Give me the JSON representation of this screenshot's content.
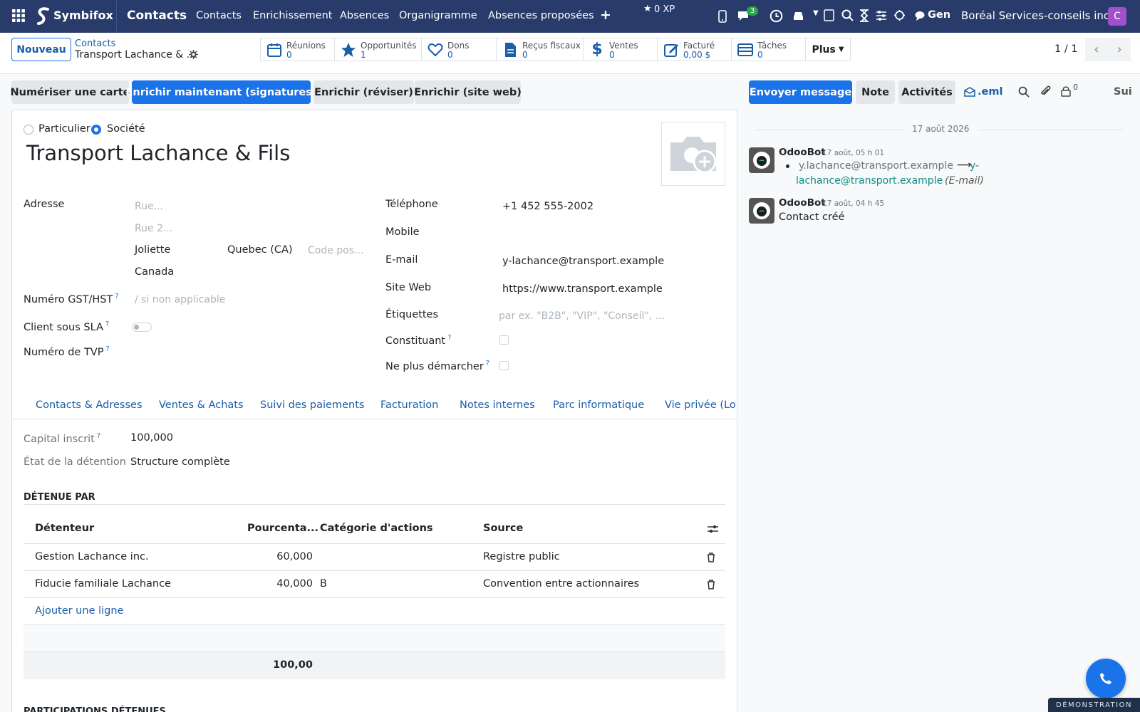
{
  "navbar": {
    "brand": "Symbifox",
    "app_title": "Contacts",
    "menu": [
      "Contacts",
      "Enrichissement",
      "Absences",
      "Organigramme",
      "Absences proposées"
    ],
    "xp": "0 XP",
    "chat_count": "3",
    "gen_label": "Gen",
    "company": "Boréal Services-conseils inc.",
    "user_initial": "C"
  },
  "control_panel": {
    "new_label": "Nouveau",
    "breadcrumb_parent": "Contacts",
    "breadcrumb_current": "Transport Lachance & ...",
    "stats": [
      {
        "label": "Réunions",
        "value": "0",
        "icon": "calendar-icon"
      },
      {
        "label": "Opportunités",
        "value": "1",
        "icon": "star-icon"
      },
      {
        "label": "Dons",
        "value": "0",
        "icon": "heart-icon"
      },
      {
        "label": "Reçus fiscaux",
        "value": "0",
        "icon": "receipt-icon"
      },
      {
        "label": "Ventes",
        "value": "0",
        "icon": "dollar-icon"
      },
      {
        "label": "Facturé",
        "value": "0,00 $",
        "icon": "edit-icon"
      },
      {
        "label": "Tâches",
        "value": "0",
        "icon": "tasks-icon"
      }
    ],
    "more_label": "Plus",
    "pager": "1 / 1"
  },
  "actions": {
    "scan": "Numériser une carte",
    "enrich_sig": "Enrichir maintenant (signatures)",
    "enrich_review": "Enrichir (réviser)",
    "enrich_web": "Enrichir (site web)"
  },
  "chatter_actions": {
    "send": "Envoyer message",
    "note": "Note",
    "activities": "Activités",
    "eml": ".eml",
    "follow_count": "0",
    "follow": "Sui"
  },
  "form": {
    "type_individual": "Particulier",
    "type_company": "Société",
    "name": "Transport Lachance & Fils",
    "address_label": "Adresse",
    "street_ph": "Rue...",
    "street2_ph": "Rue 2...",
    "city": "Joliette",
    "state": "Quebec (CA)",
    "zip_ph": "Code pos...",
    "country": "Canada",
    "gst_label": "Numéro GST/HST",
    "gst_ph": "/ si non applicable",
    "sla_label": "Client sous SLA",
    "tvp_label": "Numéro de TVP",
    "phone_label": "Téléphone",
    "phone": "+1 452 555-2002",
    "mobile_label": "Mobile",
    "email_label": "E-mail",
    "email": "y-lachance@transport.example",
    "website_label": "Site Web",
    "website": "https://www.transport.example",
    "tags_label": "Étiquettes",
    "tags_ph": "par ex. \"B2B\", \"VIP\", \"Conseil\", ...",
    "constituent_label": "Constituant",
    "dnc_label": "Ne plus démarcher"
  },
  "tabs": [
    "Contacts & Adresses",
    "Ventes & Achats",
    "Suivi des paiements",
    "Facturation",
    "Notes internes",
    "Parc informatique",
    "Vie privée (Loi"
  ],
  "ownership": {
    "capital_label": "Capital inscrit",
    "capital": "100,000",
    "state_label": "État de la détention",
    "state": "Structure complète",
    "section_title": "DÉTENUE PAR",
    "headers": [
      "Détenteur",
      "Pourcenta...",
      "Catégorie d'actions",
      "Source"
    ],
    "rows": [
      {
        "holder": "Gestion Lachance inc.",
        "pct": "60,000",
        "cat": "",
        "source": "Registre public"
      },
      {
        "holder": "Fiducie familiale Lachance",
        "pct": "40,000",
        "cat": "B",
        "source": "Convention entre actionnaires"
      }
    ],
    "add_line": "Ajouter une ligne",
    "total": "100,00",
    "next_section": "PARTICIPATIONS DÉTENUES"
  },
  "chatter": {
    "date": "17 août 2026",
    "messages": [
      {
        "author": "OdooBot",
        "time": "17 août, 05 h 01",
        "old": "y.lachance@transport.example",
        "new1": "y-",
        "new2": "lachance@transport.example",
        "field": "(E-mail)"
      },
      {
        "author": "OdooBot",
        "time": "17 août, 04 h 45",
        "body": "Contact créé"
      }
    ]
  },
  "demo_badge": "DÉMONSTRATION",
  "colors": {
    "navbar": "#283b6a",
    "primary": "#1a73e8",
    "link": "#1a5ea8"
  }
}
